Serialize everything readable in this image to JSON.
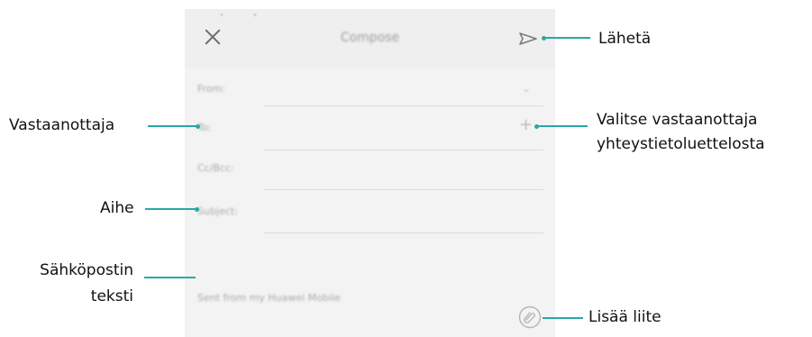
{
  "screen": {
    "title": "Compose",
    "status_text": "• •",
    "fields": {
      "from": "From:",
      "to": "To:",
      "cc_bcc": "Cc/Bcc:",
      "subject": "Subject:"
    },
    "body_text": "Sent from my Huawei Mobile",
    "icons": [
      "close-icon",
      "send-icon",
      "chevron-down-icon",
      "plus-icon",
      "attachment-icon"
    ]
  },
  "callouts": {
    "send": "Lähetä",
    "recipient": "Vastaanottaja",
    "choose_contact_line1": "Valitse vastaanottaja",
    "choose_contact_line2": "yhteystietoluettelosta",
    "subject": "Aihe",
    "body_line1": "Sähköpostin",
    "body_line2": "teksti",
    "attach": "Lisää liite"
  },
  "colors": {
    "accent": "#2aa8a4",
    "screen_bg": "#f3f3f3"
  }
}
